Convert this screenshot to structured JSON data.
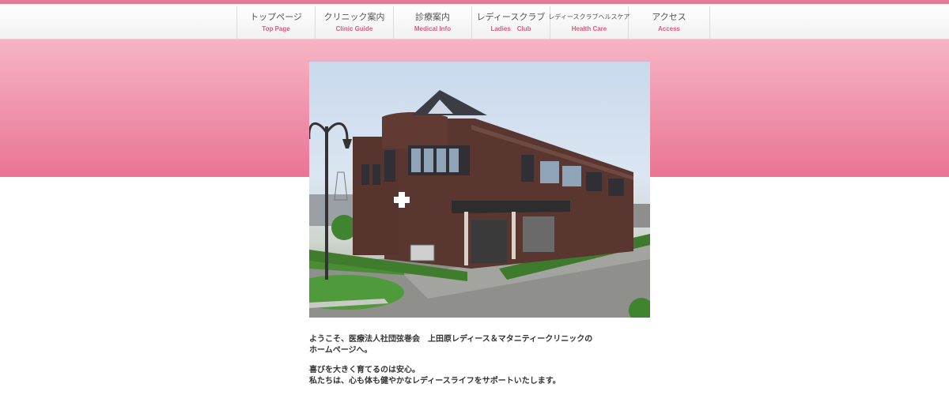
{
  "nav": {
    "items": [
      {
        "jp": "トップページ",
        "en": "Top Page"
      },
      {
        "jp": "クリニック案内",
        "en": "Clinic Guide"
      },
      {
        "jp": "診療案内",
        "en": "Medical Info"
      },
      {
        "jp": "レディースクラブ",
        "en": "Ladies　Club"
      },
      {
        "jp": "レディースクラブヘルスケア",
        "en": "Health Care"
      },
      {
        "jp": "アクセス",
        "en": "Access"
      }
    ]
  },
  "intro": {
    "line1": "ようこそ、医療法人社団弦巻会　上田原レディース＆マタニティークリニックの",
    "line2": "ホームページへ。",
    "line3": "喜びを大きく育てるのは安心。",
    "line4": "私たちは、心も体も健やかなレディースライフをサポートいたします。"
  },
  "colors": {
    "accent": "#e47b98",
    "nav_en": "#e0577e",
    "band_top": "#f6b5c6",
    "band_bottom": "#ea7494"
  }
}
